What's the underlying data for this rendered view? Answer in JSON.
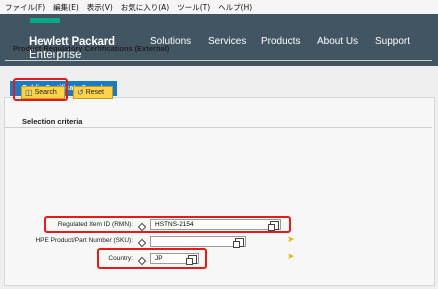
{
  "menubar": {
    "items": [
      "ファイル(F)",
      "編集(E)",
      "表示(V)",
      "お気に入り(A)",
      "ツール(T)",
      "ヘルプ(H)"
    ]
  },
  "header": {
    "logo_line1": "Hewlett Packard",
    "logo_line2": "Enterprise",
    "nav": [
      "Solutions",
      "Services",
      "Products",
      "About Us",
      "Support"
    ]
  },
  "tab": {
    "label": "Public Certificate Search"
  },
  "panel": {
    "title": "Product Regulatory Certifications (External)"
  },
  "toolbar": {
    "search_label": "Search",
    "reset_label": "Reset"
  },
  "criteria": {
    "title": "Selection criteria",
    "rmn": {
      "label": "Regulated Item ID (RMN):",
      "value": "HSTNS-2154"
    },
    "sku": {
      "label": "HPE Product/Part Number (SKU):",
      "value": ""
    },
    "country": {
      "label": "Country:",
      "value": "JP"
    }
  },
  "colors": {
    "header_bg": "#425563",
    "logo_accent": "#01a982",
    "tab_bg": "#1a7ac2",
    "button_bg": "#ffd24a",
    "highlight": "#e21b1b"
  }
}
